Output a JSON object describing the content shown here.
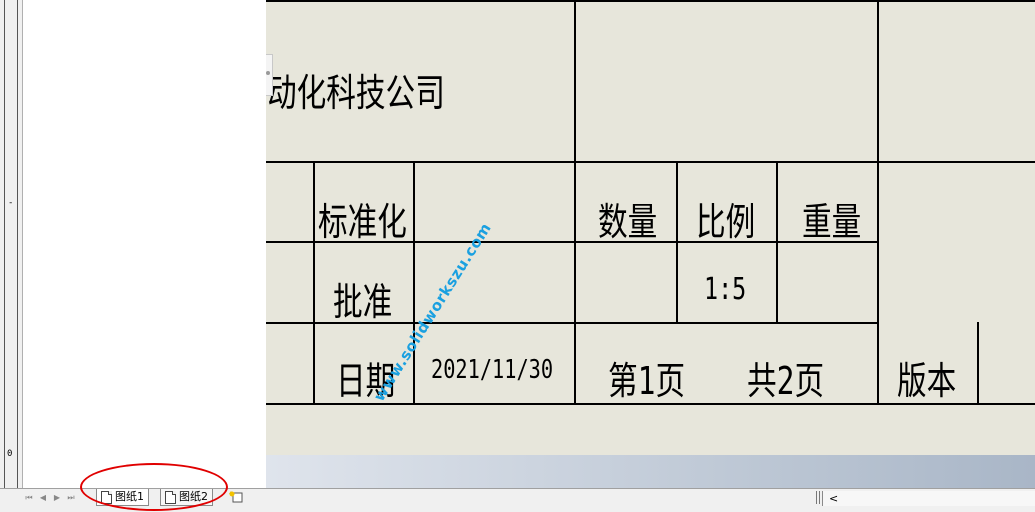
{
  "ruler": {
    "marks": [
      "-",
      "0"
    ]
  },
  "title_block": {
    "company": "动化科技公司",
    "standardization_label": "标准化",
    "approval_label": "批准",
    "date_label": "日期",
    "date_value": "2021/11/30",
    "quantity_label": "数量",
    "scale_label": "比例",
    "weight_label": "重量",
    "scale_value": "1:5",
    "page_label": "第1页",
    "total_pages_label": "共2页",
    "version_label": "版本"
  },
  "tabs": [
    {
      "label": "图纸1",
      "active": true
    },
    {
      "label": "图纸2",
      "active": false
    }
  ],
  "scroll_arrow": "<",
  "nav_buttons": [
    "⏮",
    "◀",
    "▶",
    "⏭"
  ],
  "watermark": "www.solidworkszu.com",
  "colors": {
    "sheet_background": "#e7e6db",
    "annotation_red": "#e00000",
    "watermark_blue": "#1aa0e0"
  }
}
